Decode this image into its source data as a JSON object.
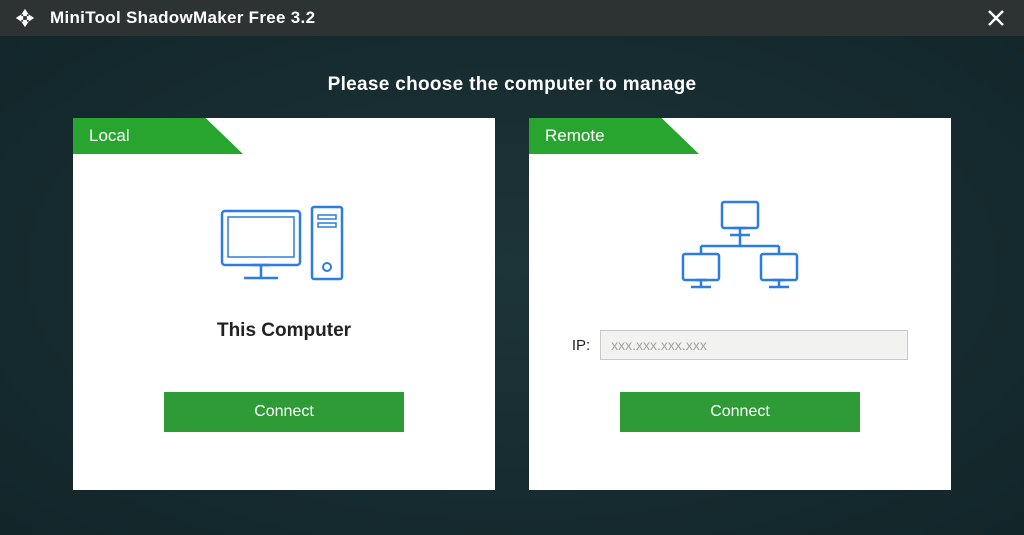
{
  "titlebar": {
    "title": "MiniTool ShadowMaker Free 3.2"
  },
  "heading": "Please choose the computer to manage",
  "cards": {
    "local": {
      "tab_label": "Local",
      "label": "This Computer",
      "connect_label": "Connect"
    },
    "remote": {
      "tab_label": "Remote",
      "ip_prefix": "IP:",
      "ip_placeholder": "xxx.xxx.xxx.xxx",
      "ip_value": "",
      "connect_label": "Connect"
    }
  },
  "colors": {
    "accent_green": "#27a52f",
    "button_green": "#2e9b37",
    "icon_blue": "#2b7de1"
  }
}
